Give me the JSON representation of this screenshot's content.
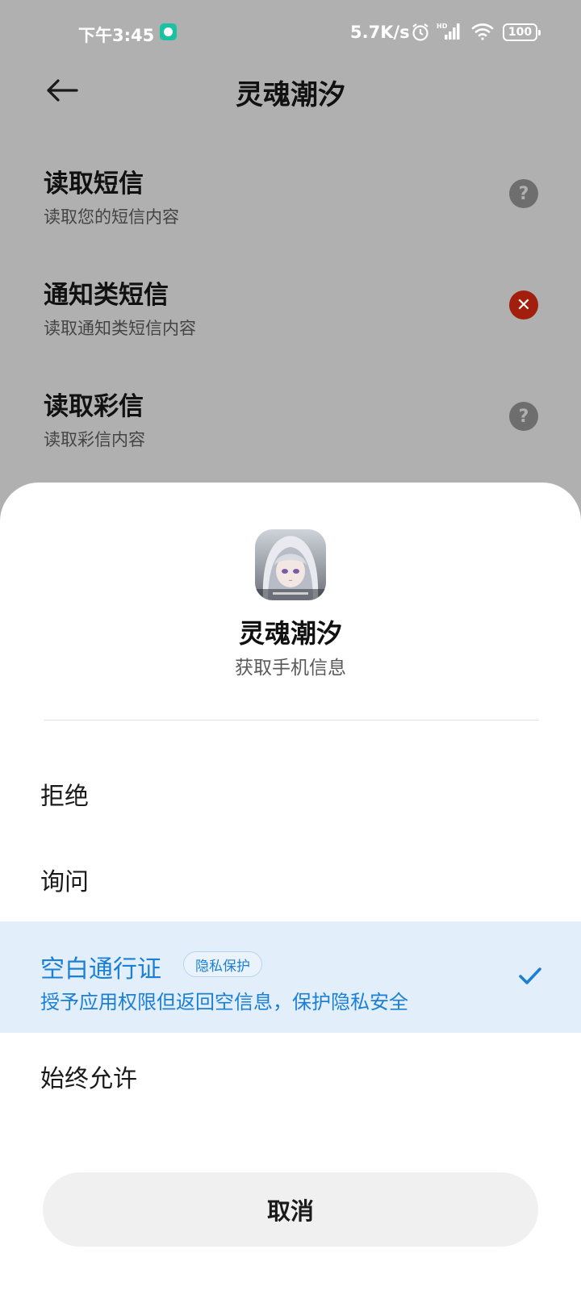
{
  "status_bar": {
    "time": "下午3:45",
    "net_speed": "5.7K/s",
    "battery": "100"
  },
  "header": {
    "title": "灵魂潮汐"
  },
  "permissions": [
    {
      "title": "读取短信",
      "subtitle": "读取您的短信内容",
      "status_icon": "question-icon",
      "status_glyph": "?"
    },
    {
      "title": "通知类短信",
      "subtitle": "读取通知类短信内容",
      "status_icon": "denied-icon",
      "status_glyph": "✕"
    },
    {
      "title": "读取彩信",
      "subtitle": "读取彩信内容",
      "status_icon": "question-icon",
      "status_glyph": "?"
    }
  ],
  "sheet": {
    "app_name": "灵魂潮汐",
    "subtitle": "获取手机信息",
    "options": [
      {
        "label": "拒绝"
      },
      {
        "label": "询问"
      },
      {
        "label": "空白通行证",
        "badge": "隐私保护",
        "desc": "授予应用权限但返回空信息，保护隐私安全",
        "selected": true
      },
      {
        "label": "始终允许"
      }
    ],
    "cancel_label": "取消"
  },
  "colors": {
    "accent": "#1b7fd6",
    "selected_bg": "#e2effb",
    "denied": "#a31f0d",
    "scrim": "#b0b0b0"
  }
}
